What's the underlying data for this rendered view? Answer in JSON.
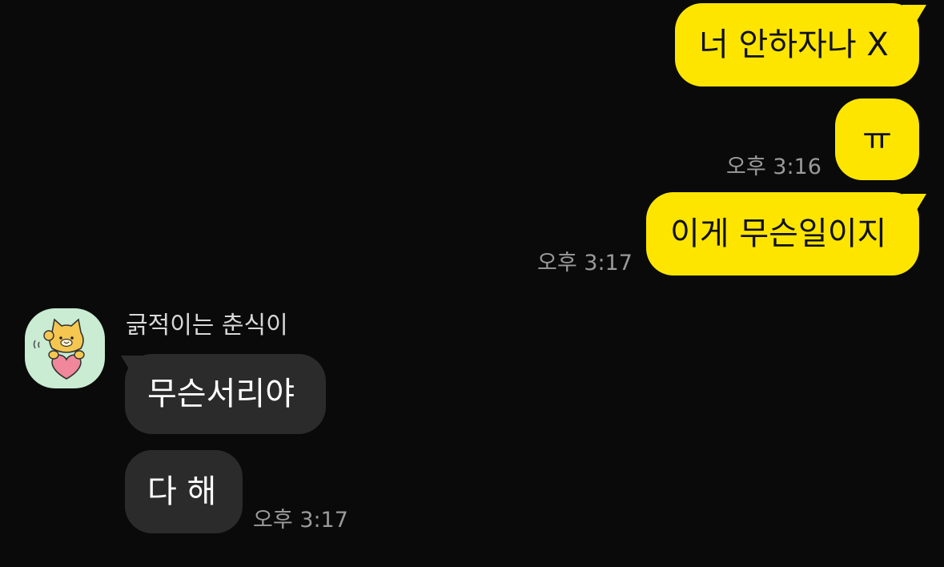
{
  "chat": {
    "outgoing": [
      {
        "text": "너 안하자나 X"
      },
      {
        "text": "ㅠ",
        "time": "오후 3:16"
      },
      {
        "text": "이게 무슨일이지",
        "time": "오후 3:17"
      }
    ],
    "incoming": {
      "sender": "긁적이는 춘식이",
      "avatar_icon": "chunsik-cat-avatar-icon",
      "messages": [
        {
          "text": "무슨서리야"
        },
        {
          "text": "다 해",
          "time": "오후 3:17"
        }
      ]
    }
  },
  "colors": {
    "background": "#0a0a0a",
    "outgoing_bubble": "#fee500",
    "incoming_bubble": "#2b2b2b",
    "avatar_background": "#c9ecd3"
  }
}
